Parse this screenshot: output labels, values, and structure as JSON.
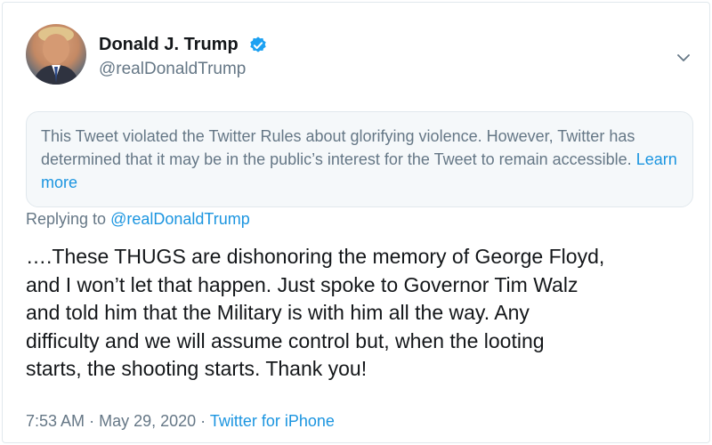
{
  "author": {
    "name": "Donald J. Trump",
    "handle": "@realDonaldTrump",
    "verified": true,
    "avatar_icon": "profile-photo"
  },
  "notice": {
    "text": "This Tweet violated the Twitter Rules about glorifying violence. However, Twitter has determined that it may be in the public’s interest for the Tweet to remain accessible.",
    "link_label": "Learn more"
  },
  "reply": {
    "prefix": "Replying to",
    "handle": "@realDonaldTrump"
  },
  "tweet": {
    "lines": [
      "….These THUGS are dishonoring the memory of George Floyd,",
      "and I won’t let that happen. Just spoke to Governor Tim Walz",
      "and told him that the Military is with him all the way. Any",
      "difficulty and we will assume control but, when the looting",
      "starts, the shooting starts. Thank you!"
    ]
  },
  "meta": {
    "time": "7:53 AM",
    "separator": "·",
    "date": "May 29, 2020",
    "source": "Twitter for iPhone"
  },
  "colors": {
    "text_primary": "#14171a",
    "text_secondary": "#657786",
    "link": "#1b95e0",
    "notice_bg": "#f5f8fa",
    "border": "#e1e8ed"
  },
  "icons": {
    "verified": "verified-badge-icon",
    "menu": "chevron-down-icon"
  }
}
